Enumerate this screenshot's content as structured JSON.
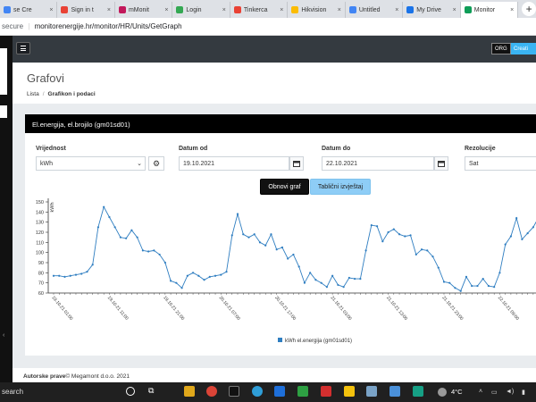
{
  "browser": {
    "tabs": [
      {
        "label": "se Cre",
        "color": "#4285f4"
      },
      {
        "label": "Sign in t",
        "color": "#e94235"
      },
      {
        "label": "mMonit",
        "color": "#c2185b"
      },
      {
        "label": "Login",
        "color": "#34a853"
      },
      {
        "label": "Tinkerca",
        "color": "#e94235"
      },
      {
        "label": "Hikvision",
        "color": "#fbbc04"
      },
      {
        "label": "Untitled",
        "color": "#4285f4"
      },
      {
        "label": "My Drive",
        "color": "#1a73e8"
      },
      {
        "label": "Monitor",
        "color": "#0f9d58"
      }
    ],
    "security": "secure",
    "url": "monitorenergije.hr/monitor/HR/Units/GetGraph"
  },
  "nav": {
    "org_label": "ORG",
    "create_label": "Creati"
  },
  "page": {
    "title": "Grafovi",
    "breadcrumb": [
      "Lista",
      "Grafikon i podaci"
    ]
  },
  "card": {
    "title": "El.energija, el.brojilo (gm01sd01)"
  },
  "form": {
    "value_label": "Vrijednost",
    "value_selected": "kWh",
    "from_label": "Datum od",
    "from_value": "19.10.2021",
    "to_label": "Datum do",
    "to_value": "22.10.2021",
    "resolution_label": "Rezolucije",
    "resolution_selected": "Sat"
  },
  "buttons": {
    "refresh": "Obnovi graf",
    "table": "Tablični izvještaj"
  },
  "chart_data": {
    "type": "line",
    "ylabel": "kWh",
    "ylim": [
      60,
      150
    ],
    "yticks": [
      60,
      70,
      80,
      90,
      100,
      110,
      120,
      130,
      140,
      150
    ],
    "xtick_labels": [
      "19.10.21 01:00",
      "19.10.21 11:00",
      "19.10.21 21:00",
      "20.10.21 07:00",
      "20.10.21 17:00",
      "21.10.21 03:00",
      "21.10.21 13:00",
      "21.10.21 23:00",
      "22.10.21 09:00"
    ],
    "xtick_every": 10,
    "color": "#2f7ec1",
    "series": [
      {
        "name": "kWh el.energija (gm01sd01)",
        "values": [
          77,
          77,
          76,
          77,
          78,
          79,
          81,
          88,
          125,
          145,
          135,
          125,
          115,
          114,
          122,
          115,
          102,
          101,
          102,
          98,
          90,
          72,
          70,
          65,
          77,
          80,
          77,
          73,
          76,
          77,
          78,
          81,
          117,
          138,
          118,
          115,
          118,
          110,
          107,
          118,
          103,
          105,
          94,
          98,
          86,
          70,
          80,
          73,
          70,
          66,
          77,
          68,
          66,
          75,
          74,
          74,
          102,
          127,
          126,
          111,
          120,
          123,
          118,
          116,
          117,
          98,
          103,
          102,
          96,
          85,
          71,
          70,
          65,
          62,
          76,
          67,
          67,
          74,
          67,
          66,
          80,
          108,
          116,
          134,
          113,
          119,
          125,
          135
        ]
      }
    ]
  },
  "footer": {
    "bold": "Autorske prave",
    "text": "© Megamont d.o.o. 2021"
  },
  "taskbar": {
    "search": "search",
    "weather": "4°C"
  }
}
